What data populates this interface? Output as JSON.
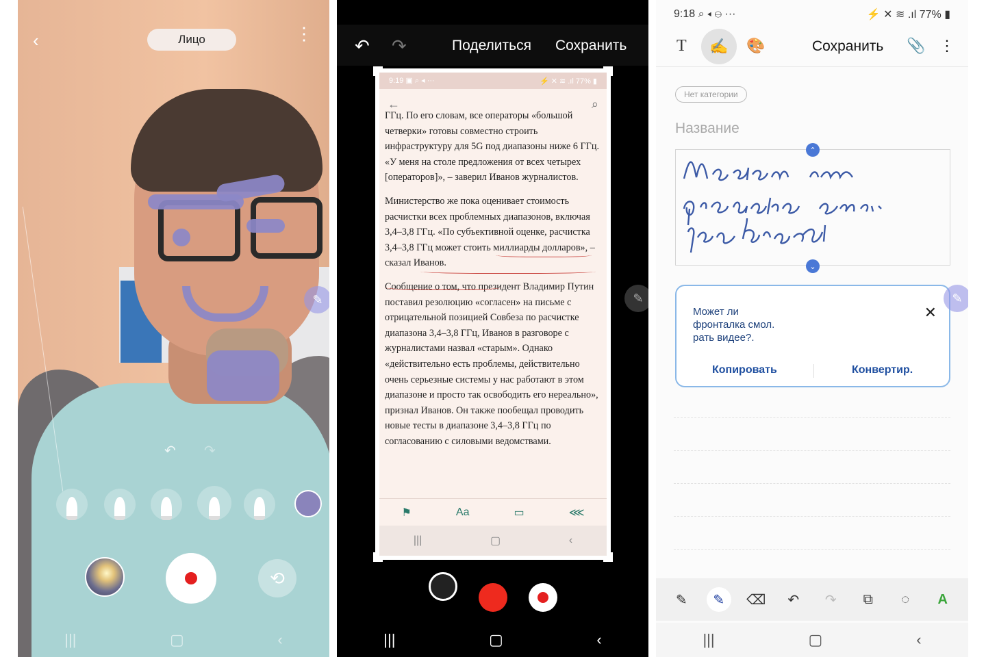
{
  "panel1": {
    "mode_pill": "Лицо",
    "back_icon": "‹",
    "more_icon": "⋮",
    "undo_icon": "↶",
    "redo_icon": "↷",
    "flip_icon": "⟲",
    "edge_pen_icon": "✎",
    "draw_color": "#8c88c8",
    "nav": [
      "|||",
      "▢",
      "‹"
    ]
  },
  "panel2": {
    "undo_icon": "↶",
    "redo_icon": "↷",
    "share_label": "Поделиться",
    "save_label": "Сохранить",
    "doc_status_time": "9:19 ▣ ⌕ ◂ ···",
    "doc_status_right": "⚡ ✕ ≋ .ıl 77% ▮",
    "doc_back_icon": "←",
    "doc_search_icon": "⌕",
    "edge_pen_icon": "✎",
    "paragraphs": [
      "ГГц. По его словам, все операторы «большой четверки» готовы совместно строить инфраструктуру для 5G под диапазоны ниже 6 ГГц. «У меня на столе предложения от всех четырех [операторов]», – заверил Иванов журналистов.",
      "Министерство же пока оценивает стоимость расчистки всех проблемных диапазонов, включая 3,4–3,8 ГГц. «По субъективной оценке, расчистка 3,4–3,8 ГГц может стоить миллиарды долларов», – сказал Иванов.",
      "Сообщение о том, что президент Владимир Путин поставил резолюцию «согласен» на письме с отрицательной позицией Совбеза по расчистке диапазона 3,4–3,8 ГГц, Иванов в разговоре с журналистами назвал «старым». Однако «действительно есть проблемы, действительно очень серьезные системы у нас работают в этом диапазоне и просто так освободить его нереально», признал Иванов. Он также пообещал проводить новые тесты в диапазоне 3,4–3,8 ГГц по согласованию с силовыми ведомствами."
    ],
    "doc_bottom_icons": [
      "⚑",
      "Aa",
      "▭",
      "⋘"
    ],
    "doc_nav": [
      "|||",
      "▢",
      "‹"
    ],
    "ink_color": "#c8403a",
    "nav": [
      "|||",
      "▢",
      "‹"
    ]
  },
  "panel3": {
    "status_time": "9:18",
    "status_icons_left": "⌕ ◂ ⊖ ···",
    "status_right": "⚡ ✕ ≋ .ıl 77% ▮",
    "text_tool_icon": "T",
    "handwriting_icon": "✍",
    "palette_icon": "🎨",
    "save_label": "Сохранить",
    "clip_icon": "📎",
    "more_icon": "⋮",
    "category_chip": "Нет категории",
    "title_placeholder": "Название",
    "handwriting_lines": [
      "Может ли",
      "фронталка смол.",
      "рать видео?"
    ],
    "handle_up": "⌃",
    "handle_down": "⌄",
    "recognized_text": "Может ли\nфронталка смол.\nрать видее?.",
    "close_icon": "✕",
    "copy_label": "Копировать",
    "convert_label": "Конвертир.",
    "edge_pen_icon": "✎",
    "bottom_tools": [
      {
        "name": "pen-star-icon",
        "glyph": "✎"
      },
      {
        "name": "pen-active-icon",
        "glyph": "✎"
      },
      {
        "name": "eraser-icon",
        "glyph": "⌫"
      },
      {
        "name": "undo-icon",
        "glyph": "↶"
      },
      {
        "name": "redo-icon",
        "glyph": "↷"
      },
      {
        "name": "image-text-icon",
        "glyph": "⧉"
      },
      {
        "name": "lasso-icon",
        "glyph": "◌"
      },
      {
        "name": "text-style-icon",
        "glyph": "A"
      }
    ],
    "ink_color": "#3c5aa6",
    "nav": [
      "|||",
      "▢",
      "‹"
    ]
  }
}
